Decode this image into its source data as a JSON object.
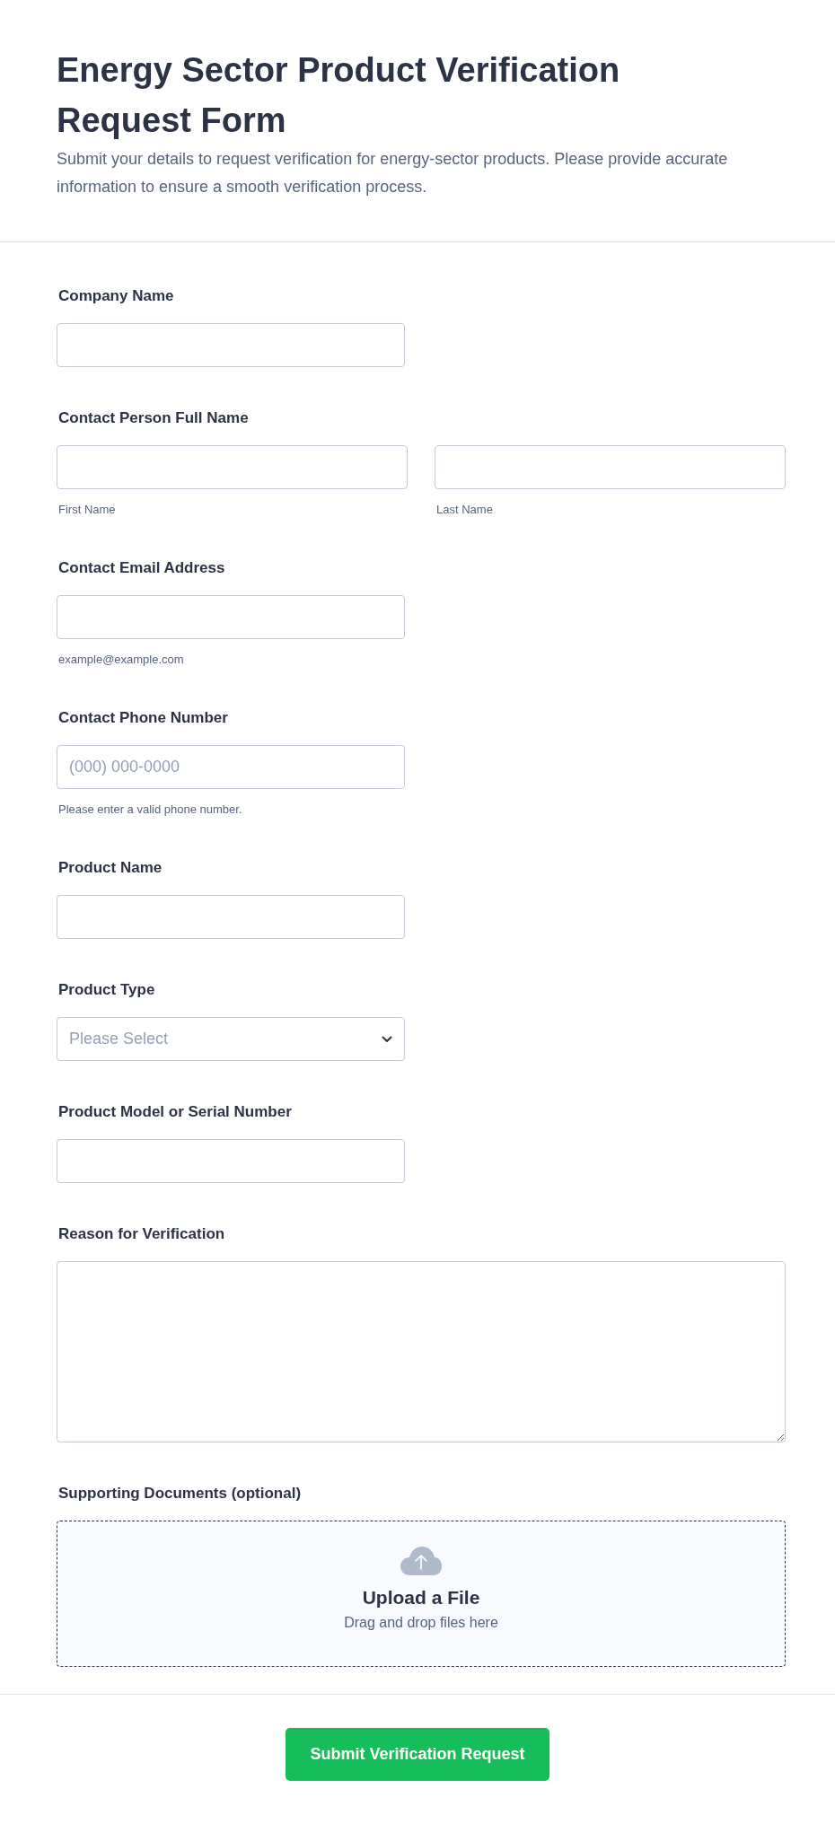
{
  "header": {
    "title": "Energy Sector Product Verification Request Form",
    "description": "Submit your details to request verification for energy-sector products. Please provide accurate information to ensure a smooth verification process."
  },
  "fields": [
    {
      "kind": "text",
      "label": "Company Name"
    },
    {
      "kind": "name_pair",
      "label": "Contact Person Full Name",
      "sublabels": [
        "First Name",
        "Last Name"
      ]
    },
    {
      "kind": "text",
      "label": "Contact Email Address",
      "hint": "example@example.com"
    },
    {
      "kind": "text",
      "label": "Contact Phone Number",
      "placeholder": "(000) 000-0000",
      "hint": "Please enter a valid phone number."
    },
    {
      "kind": "text",
      "label": "Product Name"
    },
    {
      "kind": "select",
      "label": "Product Type",
      "placeholder": "Please Select"
    },
    {
      "kind": "text",
      "label": "Product Model or Serial Number"
    },
    {
      "kind": "textarea",
      "label": "Reason for Verification"
    },
    {
      "kind": "upload",
      "label": "Supporting Documents (optional)",
      "title": "Upload a File",
      "subtitle": "Drag and drop files here"
    }
  ],
  "submit": {
    "label": "Submit Verification Request"
  }
}
